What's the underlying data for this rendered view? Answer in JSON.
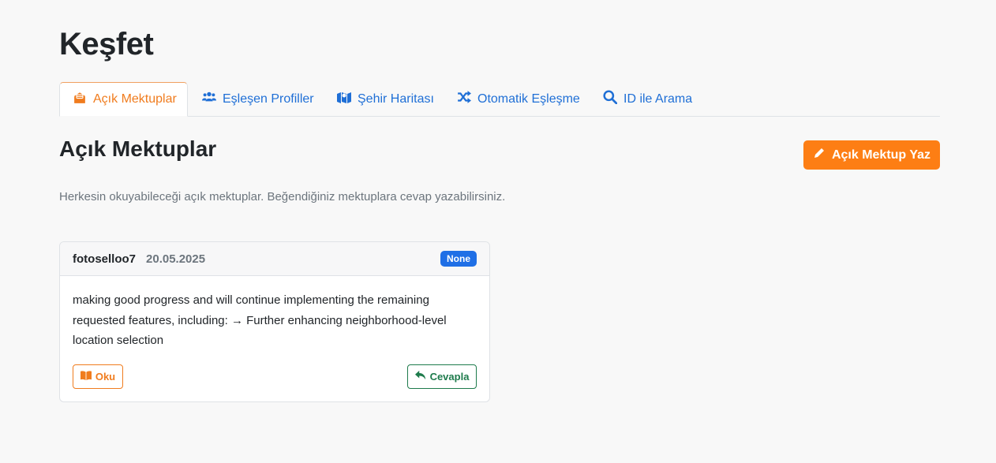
{
  "page": {
    "title": "Keşfet"
  },
  "tabs": [
    {
      "label": "Açık Mektuplar",
      "icon": "envelope-open-icon",
      "active": true
    },
    {
      "label": "Eşleşen Profiller",
      "icon": "users-icon",
      "active": false
    },
    {
      "label": "Şehir Haritası",
      "icon": "map-icon",
      "active": false
    },
    {
      "label": "Otomatik Eşleşme",
      "icon": "shuffle-icon",
      "active": false
    },
    {
      "label": "ID ile Arama",
      "icon": "search-icon",
      "active": false
    }
  ],
  "section": {
    "title": "Açık Mektuplar",
    "description": "Herkesin okuyabileceği açık mektuplar. Beğendiğiniz mektuplara cevap yazabilirsiniz.",
    "write_button_label": "Açık Mektup Yaz"
  },
  "letters": [
    {
      "author": "fotoselloo7",
      "date": "20.05.2025",
      "badge": "None",
      "body": "making good progress and will continue implementing the remaining requested features, including: → Further enhancing neighborhood-level location selection",
      "read_label": "Oku",
      "reply_label": "Cevapla"
    }
  ],
  "colors": {
    "accent": "#fd7e14",
    "link": "#1f6fd6",
    "badge": "#1f6fe6",
    "reply": "#1e7b4c",
    "background": "#f8f8f8"
  }
}
